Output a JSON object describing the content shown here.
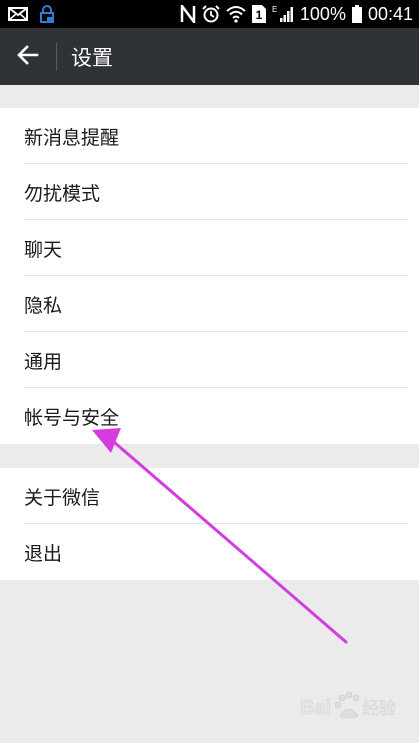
{
  "status_bar": {
    "battery_percent": "100%",
    "time": "00:41",
    "network_label": "E",
    "sim_label": "1",
    "nfc_label": "N",
    "icons": [
      "mail-icon",
      "lock-notification-icon",
      "nfc-icon",
      "alarm-icon",
      "wifi-icon",
      "sim-icon",
      "signal-icon",
      "battery-icon"
    ]
  },
  "header": {
    "title": "设置",
    "back_icon": "arrow-left-icon"
  },
  "settings": {
    "group1": [
      {
        "label": "新消息提醒"
      },
      {
        "label": "勿扰模式"
      },
      {
        "label": "聊天"
      },
      {
        "label": "隐私"
      },
      {
        "label": "通用"
      },
      {
        "label": "帐号与安全"
      }
    ],
    "group2": [
      {
        "label": "关于微信"
      },
      {
        "label": "退出"
      }
    ]
  },
  "annotation": {
    "arrow_color": "#d63be0"
  },
  "watermark": {
    "text": "Bai  经验"
  }
}
